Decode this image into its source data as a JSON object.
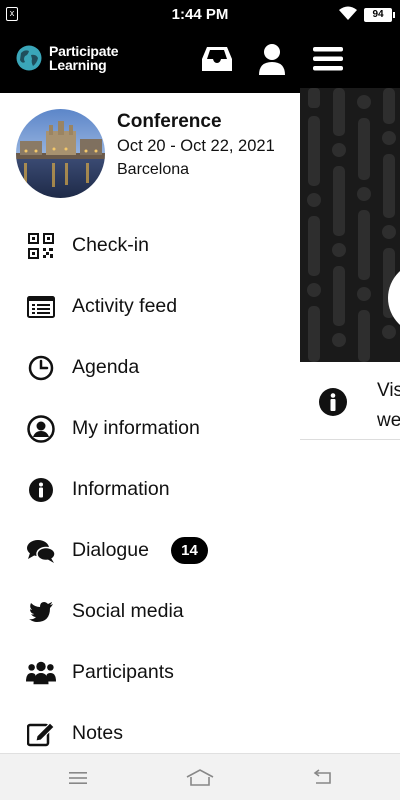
{
  "status_bar": {
    "time": "1:44 PM",
    "battery": "94",
    "notification_icon": "x",
    "icons": [
      "notification-icon",
      "wifi-icon",
      "battery-icon"
    ]
  },
  "app_bar": {
    "logo_line1": "Participate",
    "logo_line2": "Learning",
    "icons": [
      "inbox-icon",
      "profile-icon",
      "hamburger-menu-icon"
    ]
  },
  "event": {
    "name": "Conference",
    "dates": "Oct 20 - Oct 22, 2021",
    "location": "Barcelona"
  },
  "menu": [
    {
      "label": "Check-in",
      "icon": "qr-code-icon"
    },
    {
      "label": "Activity feed",
      "icon": "list-icon"
    },
    {
      "label": "Agenda",
      "icon": "clock-icon"
    },
    {
      "label": "My information",
      "icon": "user-circle-icon"
    },
    {
      "label": "Information",
      "icon": "info-icon"
    },
    {
      "label": "Dialogue",
      "icon": "chat-bubbles-icon",
      "badge": "14"
    },
    {
      "label": "Social media",
      "icon": "twitter-icon"
    },
    {
      "label": "Participants",
      "icon": "users-icon"
    },
    {
      "label": "Notes",
      "icon": "edit-note-icon"
    }
  ],
  "background_content": {
    "info_text": "Vis\nwe"
  },
  "nav_bar": {
    "icons": [
      "recents-icon",
      "home-icon",
      "back-icon"
    ]
  },
  "colors": {
    "appbar": "#000000",
    "badge": "#000000",
    "text": "#111111",
    "navbar": "#f2f2f2"
  }
}
